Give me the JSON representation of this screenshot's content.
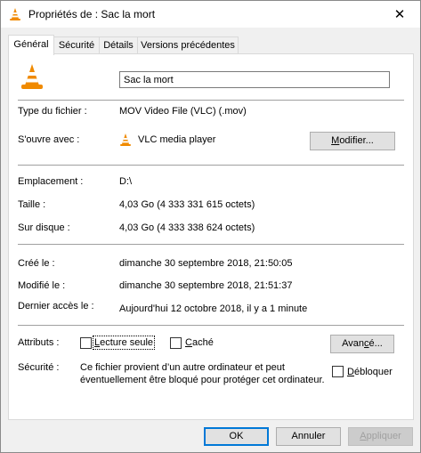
{
  "window": {
    "title": "Propriétés de : Sac la mort",
    "close_glyph": "✕"
  },
  "tabs": [
    {
      "label": "Général",
      "active": true
    },
    {
      "label": "Sécurité",
      "active": false
    },
    {
      "label": "Détails",
      "active": false
    },
    {
      "label": "Versions précédentes",
      "active": false
    }
  ],
  "file": {
    "icon": "vlc-cone-icon",
    "name": "Sac la mort"
  },
  "type": {
    "label": "Type du fichier :",
    "value": "MOV Video File (VLC) (.mov)"
  },
  "opens_with": {
    "label": "S'ouvre avec :",
    "app_icon": "vlc-cone-icon",
    "value": "VLC media player",
    "button_prefix": "M",
    "button_rest": "odifier..."
  },
  "location": {
    "label": "Emplacement :",
    "value": "D:\\"
  },
  "size": {
    "label": "Taille :",
    "value": "4,03 Go (4 333 331 615 octets)"
  },
  "disk_size": {
    "label": "Sur disque :",
    "value": "4,03 Go (4 333 338 624 octets)"
  },
  "created": {
    "label": "Créé le :",
    "value": "dimanche 30 septembre 2018, 21:50:05"
  },
  "modified": {
    "label": "Modifié le :",
    "value": "dimanche 30 septembre 2018, 21:51:37"
  },
  "accessed": {
    "label": "Dernier accès le :",
    "value": "Aujourd'hui 12 octobre 2018, il y a 1 minute"
  },
  "attributes": {
    "label": "Attributs :",
    "readonly_prefix": "L",
    "readonly_rest": "ecture seule",
    "readonly_checked": false,
    "hidden_prefix": "C",
    "hidden_rest": "aché",
    "hidden_checked": false,
    "advanced_prefix": "Avan",
    "advanced_accel": "c",
    "advanced_rest": "é..."
  },
  "security": {
    "label": "Sécurité :",
    "line1": "Ce fichier provient d’un autre ordinateur et peut",
    "line2": "éventuellement être bloqué pour protéger cet ordinateur.",
    "unblock_prefix": "D",
    "unblock_rest": "ébloquer",
    "unblock_checked": false
  },
  "footer": {
    "ok": "OK",
    "cancel": "Annuler",
    "apply_prefix": "A",
    "apply_rest": "ppliquer"
  },
  "colors": {
    "vlc_orange": "#f08a00",
    "vlc_white": "#ffffff",
    "accent": "#0078d7"
  }
}
